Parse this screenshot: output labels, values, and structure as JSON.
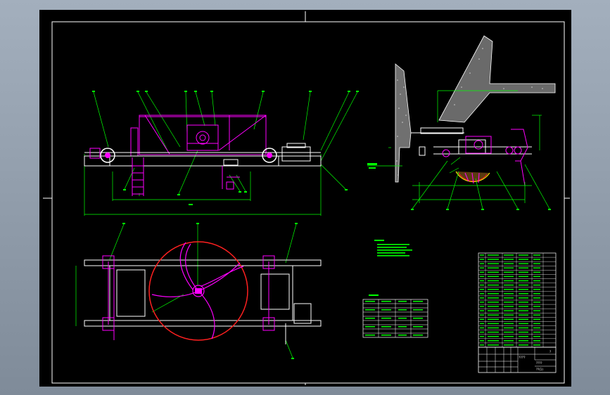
{
  "drawing": {
    "title_block": {
      "label_a": "????",
      "label_b": "??(1)",
      "scale_label": "?"
    }
  },
  "colors": {
    "outline": "#ffffff",
    "part": "#ff00ff",
    "dim": "#00ff00",
    "hatch": "#9a9a9a",
    "hidden": "#ffff00",
    "red": "#ff2020"
  }
}
